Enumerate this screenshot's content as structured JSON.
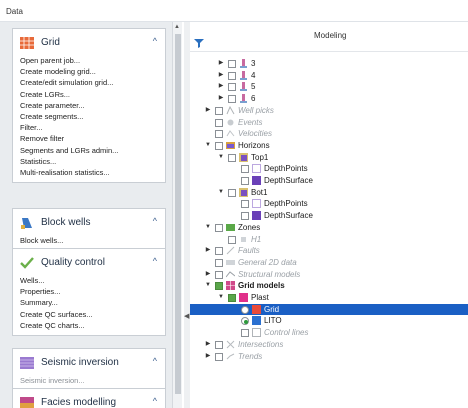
{
  "window": {
    "title": "Data"
  },
  "left_panels": [
    {
      "title": "Grid",
      "icon": "grid-icon",
      "items": [
        "Open parent job...",
        "Create modeling grid...",
        "Create/edit simulation grid...",
        "Create LGRs...",
        "Create parameter...",
        "Create segments...",
        "Filter...",
        "Remove filter",
        "Segments and LGRs admin...",
        "Statistics...",
        "Multi-realisation statistics..."
      ]
    },
    {
      "title": "Block wells",
      "icon": "block-wells-icon",
      "items": [
        "Block wells..."
      ]
    },
    {
      "title": "Quality control",
      "icon": "checkmark-icon",
      "items": [
        "Wells...",
        "Properties...",
        "Summary...",
        "Create QC surfaces...",
        "Create QC charts..."
      ]
    },
    {
      "title": "Seismic inversion",
      "icon": "seismic-icon",
      "items": [
        "Seismic inversion..."
      ]
    },
    {
      "title": "Facies modelling",
      "icon": "facies-icon",
      "items": []
    }
  ],
  "modeling": {
    "title": "Modeling",
    "tree": [
      {
        "label": "3",
        "level": 1,
        "expander": "right",
        "checkbox": "off",
        "icon": "well-icon",
        "style": "normal"
      },
      {
        "label": "4",
        "level": 1,
        "expander": "right",
        "checkbox": "off",
        "icon": "well-icon",
        "style": "normal"
      },
      {
        "label": "5",
        "level": 1,
        "expander": "right",
        "checkbox": "off",
        "icon": "well-icon",
        "style": "normal"
      },
      {
        "label": "6",
        "level": 1,
        "expander": "right",
        "checkbox": "off",
        "icon": "well-icon",
        "style": "normal"
      },
      {
        "label": "Well picks",
        "level": 0,
        "expander": "right",
        "checkbox": "off",
        "icon": "picks-icon",
        "style": "italic"
      },
      {
        "label": "Events",
        "level": 0,
        "expander": "none",
        "checkbox": "off",
        "icon": "events-icon",
        "style": "italic"
      },
      {
        "label": "Velocities",
        "level": 0,
        "expander": "none",
        "checkbox": "off",
        "icon": "velocity-icon",
        "style": "italic"
      },
      {
        "label": "Horizons",
        "level": 0,
        "expander": "down",
        "checkbox": "off",
        "icon": "horizon-folder-icon",
        "style": "normal"
      },
      {
        "label": "Top1",
        "level": 1,
        "expander": "down",
        "checkbox": "off",
        "icon": "horizon-icon",
        "style": "normal"
      },
      {
        "label": "DepthPoints",
        "level": 2,
        "expander": "none",
        "checkbox": "off",
        "icon": "points-icon",
        "style": "normal"
      },
      {
        "label": "DepthSurface",
        "level": 2,
        "expander": "none",
        "checkbox": "off",
        "icon": "surface-icon",
        "style": "normal"
      },
      {
        "label": "Bot1",
        "level": 1,
        "expander": "down",
        "checkbox": "off",
        "icon": "horizon-icon",
        "style": "normal"
      },
      {
        "label": "DepthPoints",
        "level": 2,
        "expander": "none",
        "checkbox": "off",
        "icon": "points-icon",
        "style": "normal"
      },
      {
        "label": "DepthSurface",
        "level": 2,
        "expander": "none",
        "checkbox": "off",
        "icon": "surface-icon",
        "style": "normal"
      },
      {
        "label": "Zones",
        "level": 0,
        "expander": "down",
        "checkbox": "off",
        "icon": "zones-icon",
        "style": "normal"
      },
      {
        "label": "H1",
        "level": 1,
        "expander": "none",
        "checkbox": "off",
        "icon": "zone-icon",
        "style": "italic"
      },
      {
        "label": "Faults",
        "level": 0,
        "expander": "right",
        "checkbox": "off",
        "icon": "faults-icon",
        "style": "italic"
      },
      {
        "label": "General 2D data",
        "level": 0,
        "expander": "none",
        "checkbox": "off",
        "icon": "data-2d-icon",
        "style": "italic"
      },
      {
        "label": "Structural models",
        "level": 0,
        "expander": "right",
        "checkbox": "off",
        "icon": "structural-icon",
        "style": "italic"
      },
      {
        "label": "Grid models",
        "level": 0,
        "expander": "down",
        "checkbox": "on",
        "icon": "grid-models-icon",
        "style": "bold"
      },
      {
        "label": "Plast",
        "level": 1,
        "expander": "down",
        "checkbox": "on",
        "icon": "grid-icon",
        "style": "normal"
      },
      {
        "label": "Grid",
        "level": 2,
        "expander": "none",
        "checkbox": "radio",
        "icon": "grid-cell-icon",
        "style": "normal",
        "selected": true
      },
      {
        "label": "LITO",
        "level": 2,
        "expander": "none",
        "checkbox": "radio-on",
        "icon": "property-icon",
        "style": "normal"
      },
      {
        "label": "Control lines",
        "level": 2,
        "expander": "none",
        "checkbox": "off",
        "icon": "lines-icon",
        "style": "italic"
      },
      {
        "label": "Intersections",
        "level": 0,
        "expander": "right",
        "checkbox": "off",
        "icon": "intersection-icon",
        "style": "italic"
      },
      {
        "label": "Trends",
        "level": 0,
        "expander": "right",
        "checkbox": "off",
        "icon": "trends-icon",
        "style": "italic"
      }
    ]
  },
  "colors": {
    "selection": "#1a5fc4",
    "accent": "#3a5d8c",
    "panel_bg": "#e9ecef"
  }
}
